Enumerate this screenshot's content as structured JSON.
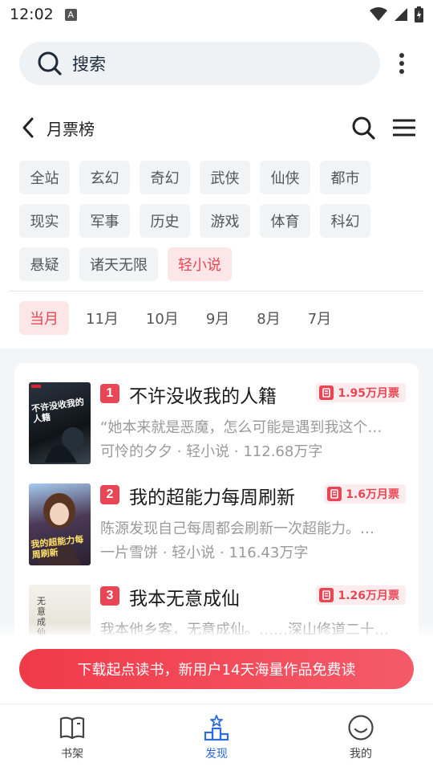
{
  "status_bar": {
    "time": "12:02",
    "notif_letter": "A"
  },
  "search": {
    "placeholder": "搜索"
  },
  "header": {
    "title": "月票榜"
  },
  "categories": [
    "全站",
    "玄幻",
    "奇幻",
    "武侠",
    "仙侠",
    "都市",
    "现实",
    "军事",
    "历史",
    "游戏",
    "体育",
    "科幻",
    "悬疑",
    "诸天无限",
    "轻小说"
  ],
  "active_category": "轻小说",
  "months": [
    "当月",
    "11月",
    "10月",
    "9月",
    "8月",
    "7月"
  ],
  "active_month": "当月",
  "books": [
    {
      "rank": "1",
      "title": "不许没收我的人籍",
      "votes": "1.95万月票",
      "desc": "“她本来就是恶魔，怎么可能是遇到我这个…",
      "author": "可怜的夕夕",
      "category": "轻小说",
      "words": "112.68万字",
      "cover_text": "不许没收我的人籍"
    },
    {
      "rank": "2",
      "title": "我的超能力每周刷新",
      "votes": "1.6万月票",
      "desc": "陈源发现自己每周都会刷新一次超能力。…",
      "author": "一片雪饼",
      "category": "轻小说",
      "words": "116.43万字",
      "cover_text": "我的超能力每周刷新"
    },
    {
      "rank": "3",
      "title": "我本无意成仙",
      "votes": "1.26万月票",
      "desc": "我本他乡客，无意成仙。……深山修道二十…",
      "author": "",
      "category": "",
      "words": "",
      "cover_text": "无意成仙"
    }
  ],
  "cta": {
    "label": "下载起点读书，新用户14天海量作品免费读"
  },
  "bottom_nav": [
    {
      "label": "书架",
      "icon": "book-icon",
      "active": false
    },
    {
      "label": "发现",
      "icon": "podium-icon",
      "active": true
    },
    {
      "label": "我的",
      "icon": "smile-icon",
      "active": false
    }
  ],
  "colors": {
    "accent": "#e84654",
    "nav_active": "#2c6be0",
    "tag_bg": "#f2f3f5"
  }
}
